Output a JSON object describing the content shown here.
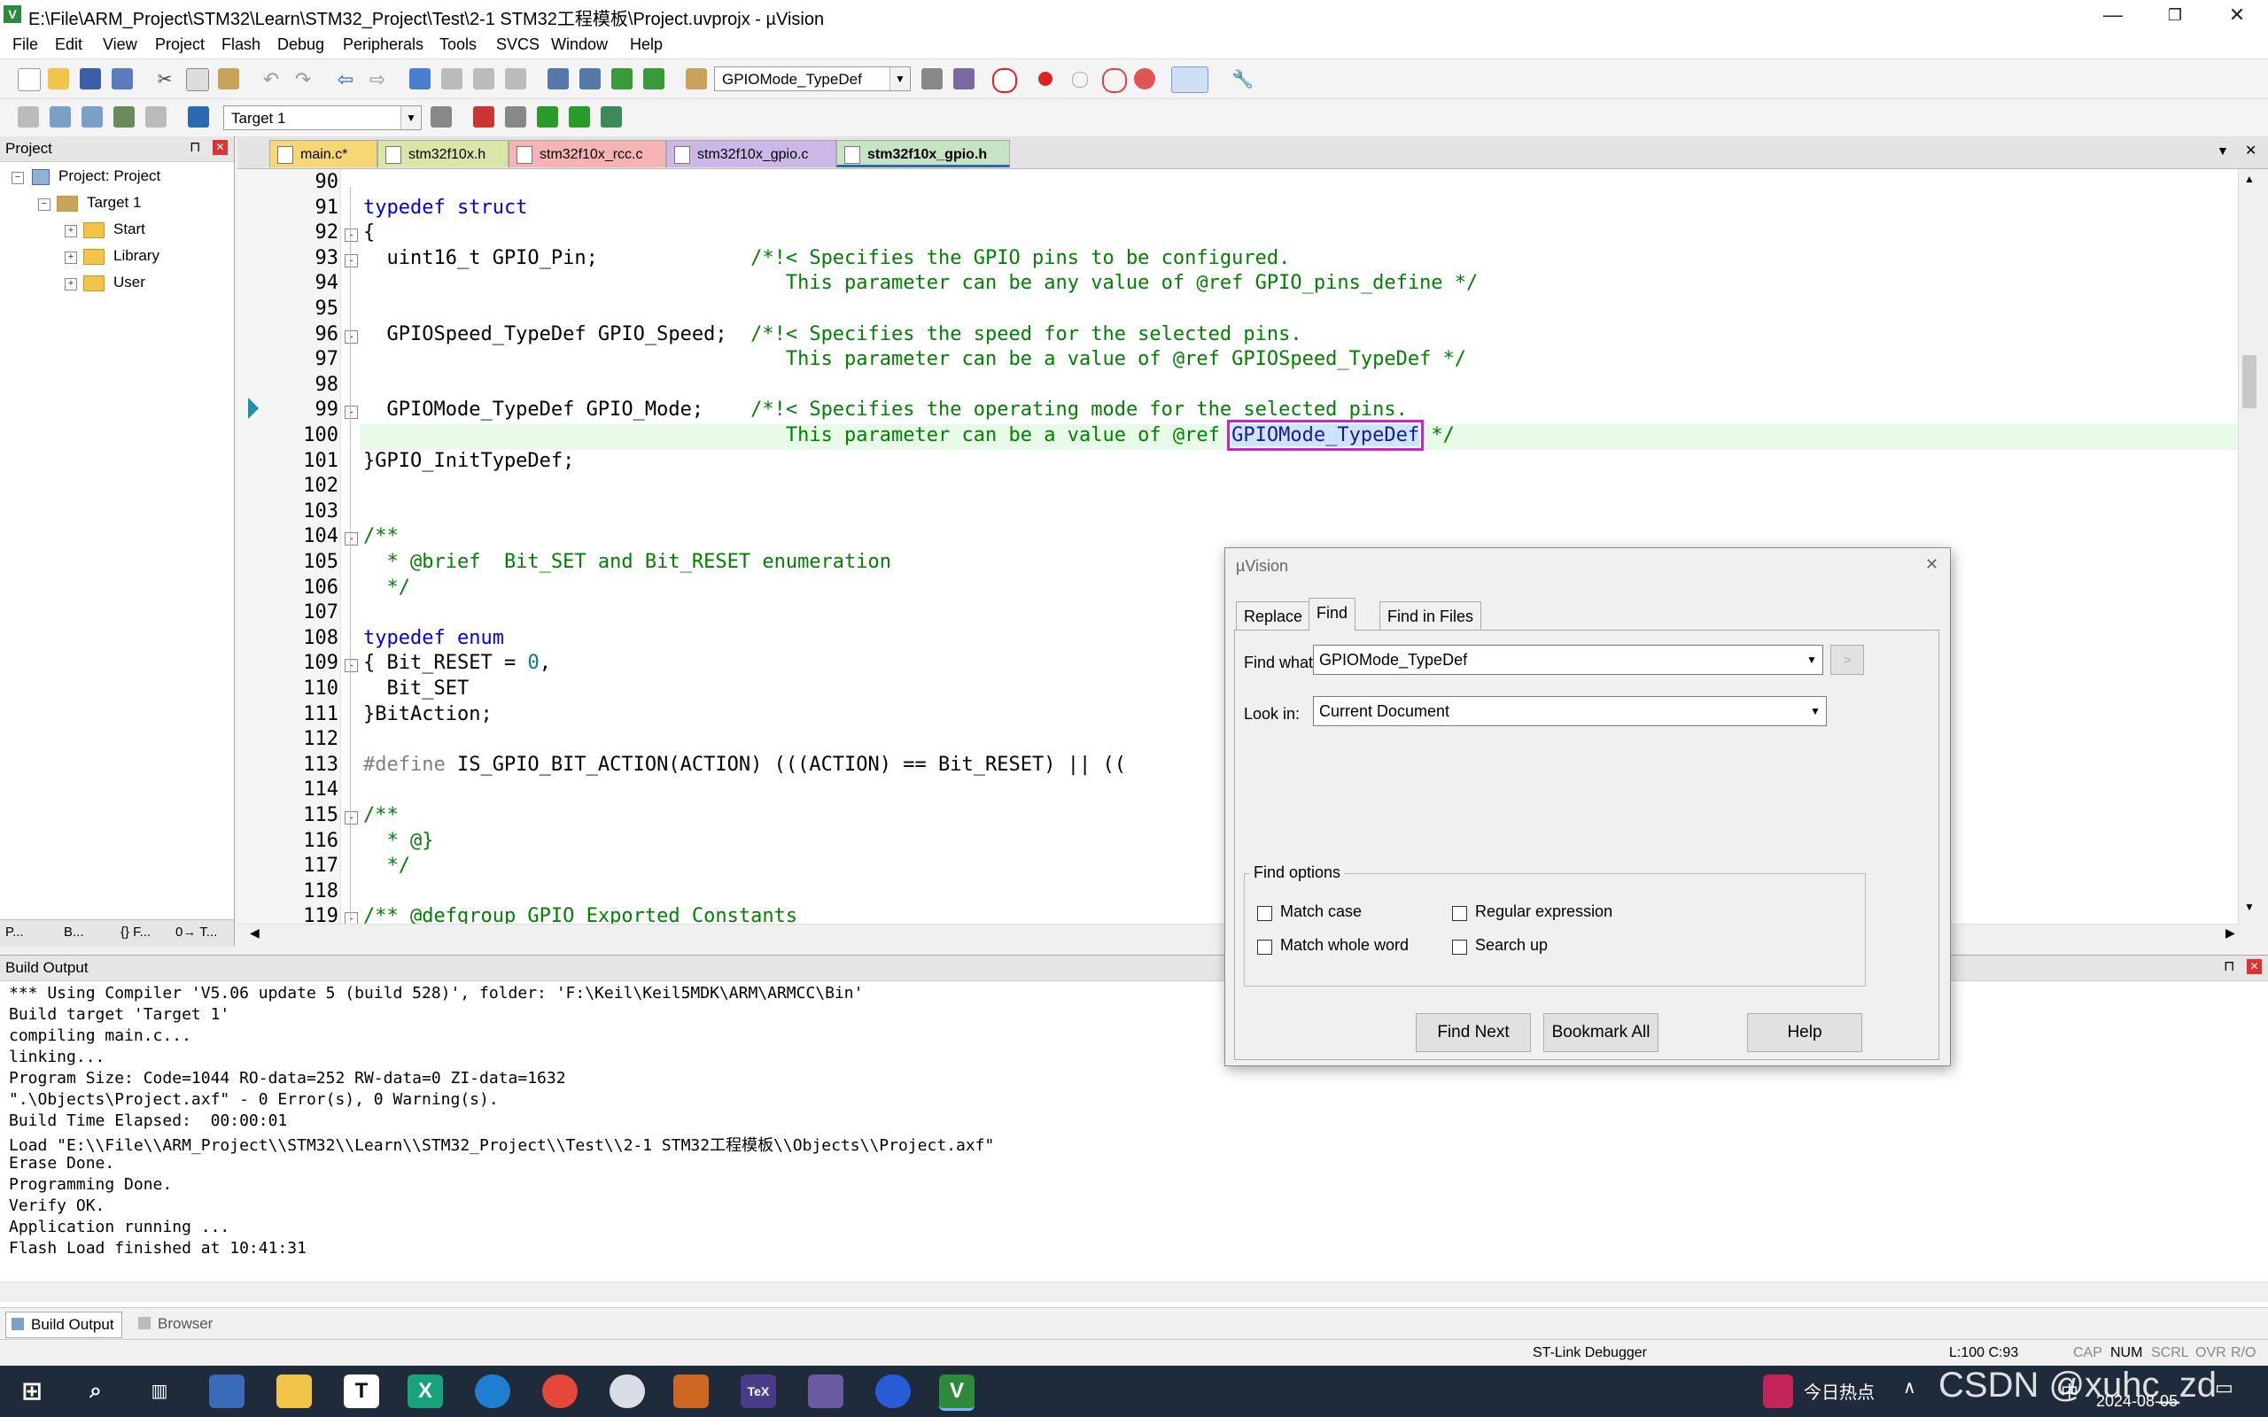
{
  "window": {
    "title": "E:\\File\\ARM_Project\\STM32\\Learn\\STM32_Project\\Test\\2-1 STM32工程模板\\Project.uvprojx - µVision",
    "app_icon": "V",
    "minimize": "—",
    "restore": "❐",
    "close": "✕"
  },
  "menu": [
    "File",
    "Edit",
    "View",
    "Project",
    "Flash",
    "Debug",
    "Peripherals",
    "Tools",
    "SVCS",
    "Window",
    "Help"
  ],
  "toolbar": {
    "find_combo": "GPIOMode_TypeDef",
    "target_combo": "Target 1"
  },
  "project_panel": {
    "header": "Project",
    "pin": "⊓",
    "close": "✕",
    "root": "Project: Project",
    "target": "Target 1",
    "groups": [
      "Start",
      "Library",
      "User"
    ],
    "bottom_tabs": [
      "P...",
      "B...",
      "{} F...",
      "0→ T..."
    ]
  },
  "editor": {
    "tabs": [
      {
        "label": "main.c*",
        "color": "#f7d774",
        "active": false
      },
      {
        "label": "stm32f10x.h",
        "color": "#d9e6a6",
        "active": false
      },
      {
        "label": "stm32f10x_rcc.c",
        "color": "#f5b3b3",
        "active": false
      },
      {
        "label": "stm32f10x_gpio.c",
        "color": "#cdb7e8",
        "active": false
      },
      {
        "label": "stm32f10x_gpio.h",
        "color": "#c6e3c3",
        "active": true
      }
    ],
    "tabs_menu": "▼",
    "tabs_close": "✕",
    "highlight_color": "#e8fbe8",
    "selection_color": "#cc22cc",
    "lines": [
      {
        "n": "90",
        "html": ""
      },
      {
        "n": "91",
        "html": "<span class='kw'>typedef struct</span>"
      },
      {
        "n": "92",
        "html": "{",
        "fold": "-"
      },
      {
        "n": "93",
        "html": "  uint16_t GPIO_Pin;             <span class='cm'>/*!&lt; Specifies the GPIO pins to be configured.</span>",
        "fold": "-"
      },
      {
        "n": "94",
        "html": "                                    <span class='cm'>This parameter can be any value of @ref GPIO_pins_define */</span>"
      },
      {
        "n": "95",
        "html": ""
      },
      {
        "n": "96",
        "html": "  GPIOSpeed_TypeDef GPIO_Speed;  <span class='cm'>/*!&lt; Specifies the speed for the selected pins.</span>",
        "fold": "-"
      },
      {
        "n": "97",
        "html": "                                    <span class='cm'>This parameter can be a value of @ref GPIOSpeed_TypeDef */</span>"
      },
      {
        "n": "98",
        "html": ""
      },
      {
        "n": "99",
        "html": "  GPIOMode_TypeDef GPIO_Mode;    <span class='cm'>/*!&lt; Specifies the operating mode for the selected pins.</span>",
        "fold": "-"
      },
      {
        "n": "100",
        "html": "                                    <span class='cm'>This parameter can be a value of @ref </span><span class='sel'>GPIOMode_TypeDef</span><span class='cm'> */</span>",
        "current": true
      },
      {
        "n": "101",
        "html": "}GPIO_InitTypeDef;"
      },
      {
        "n": "102",
        "html": ""
      },
      {
        "n": "103",
        "html": ""
      },
      {
        "n": "104",
        "html": "<span class='cm'>/**</span>",
        "fold": "-"
      },
      {
        "n": "105",
        "html": "<span class='cm'>  * @brief  Bit_SET and Bit_RESET enumeration</span>"
      },
      {
        "n": "106",
        "html": "<span class='cm'>  */</span>"
      },
      {
        "n": "107",
        "html": ""
      },
      {
        "n": "108",
        "html": "<span class='kw'>typedef enum</span>"
      },
      {
        "n": "109",
        "html": "{ Bit_RESET = <span class='num'>0</span>,",
        "fold": "-"
      },
      {
        "n": "110",
        "html": "  Bit_SET"
      },
      {
        "n": "111",
        "html": "}BitAction;"
      },
      {
        "n": "112",
        "html": ""
      },
      {
        "n": "113",
        "html": "<span class='pp'>#define</span> IS_GPIO_BIT_ACTION(ACTION) (((ACTION) == Bit_RESET) || (("
      },
      {
        "n": "114",
        "html": ""
      },
      {
        "n": "115",
        "html": "<span class='cm'>/**</span>",
        "fold": "-"
      },
      {
        "n": "116",
        "html": "<span class='cm'>  * @}</span>"
      },
      {
        "n": "117",
        "html": "<span class='cm'>  */</span>"
      },
      {
        "n": "118",
        "html": ""
      },
      {
        "n": "119",
        "html": "<span class='cm'>/** @defgroup GPIO_Exported_Constants</span>",
        "fold": "-"
      }
    ]
  },
  "dialog": {
    "title": "µVision",
    "close": "✕",
    "tabs": [
      "Replace",
      "Find",
      "Find in Files"
    ],
    "find_what_label": "Find what:",
    "find_what_value": "GPIOMode_TypeDef",
    "look_in_label": "Look in:",
    "look_in_value": "Current Document",
    "more_button": ">",
    "options_label": "Find options",
    "match_case": "Match case",
    "match_whole_word": "Match whole word",
    "regular_expression": "Regular expression",
    "search_up": "Search up",
    "find_next": "Find Next",
    "bookmark_all": "Bookmark All",
    "help": "Help"
  },
  "build_output": {
    "header": "Build Output",
    "lines": [
      "*** Using Compiler 'V5.06 update 5 (build 528)', folder: 'F:\\Keil\\Keil5MDK\\ARM\\ARMCC\\Bin'",
      "Build target 'Target 1'",
      "compiling main.c...",
      "linking...",
      "Program Size: Code=1044 RO-data=252 RW-data=0 ZI-data=1632",
      "\".\\Objects\\Project.axf\" - 0 Error(s), 0 Warning(s).",
      "Build Time Elapsed:  00:00:01",
      "Load \"E:\\\\File\\\\ARM_Project\\\\STM32\\\\Learn\\\\STM32_Project\\\\Test\\\\2-1 STM32工程模板\\\\Objects\\\\Project.axf\"",
      "Erase Done.",
      "Programming Done.",
      "Verify OK.",
      "Application running ...",
      "Flash Load finished at 10:41:31"
    ],
    "tabs": [
      "Build Output",
      "Browser"
    ]
  },
  "status": {
    "debugger": "ST-Link Debugger",
    "position": "L:100 C:93",
    "indicators": [
      "CAP",
      "NUM",
      "SCRL",
      "OVR",
      "R/O"
    ]
  },
  "taskbar": {
    "hot_news": "今日热点",
    "date": "2024-08-05",
    "watermark": "CSDN @xuhc_zd",
    "ime": "中"
  }
}
